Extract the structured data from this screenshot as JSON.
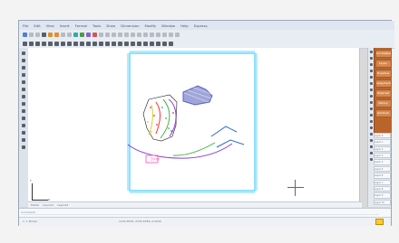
{
  "window": {
    "menu_items": [
      "File",
      "Edit",
      "View",
      "Insert",
      "Format",
      "Tools",
      "Draw",
      "Dimension",
      "Modify",
      "Window",
      "Help",
      "Express"
    ],
    "tabs": [
      "Model",
      "Layout1",
      "Layout2"
    ],
    "status_text": "1: 1 Model",
    "coordinates": "1234.5678, 2345.6789, 0.0000",
    "command_lines": [
      "Command:",
      "Command:"
    ]
  },
  "right_panel": {
    "items": [
      "Tool Palettes",
      "Layers",
      "Properties",
      "DesignCenter",
      "Sheet Set",
      "Markup",
      "QuickCalc"
    ],
    "list_items": [
      "Layer 0",
      "Layer 1",
      "Layer 2",
      "Layer 3",
      "Layer 4",
      "Layer 5",
      "Layer 6",
      "Layer 7",
      "Layer 8",
      "Layer 9",
      "Layer 10"
    ]
  },
  "drawing": {
    "label": "Dxxx",
    "title_frame": "",
    "annotations": [
      "",
      ""
    ]
  },
  "colors": {
    "accent_cyan": "#6cd7ff",
    "accent_blue": "#2c67d6",
    "accent_orange": "#b9652a",
    "drawing_red": "#ff2b2b",
    "drawing_green": "#42b042",
    "drawing_yellow": "#d9d12c",
    "drawing_purple": "#8b3ee0",
    "drawing_pink": "#ff73b8"
  }
}
